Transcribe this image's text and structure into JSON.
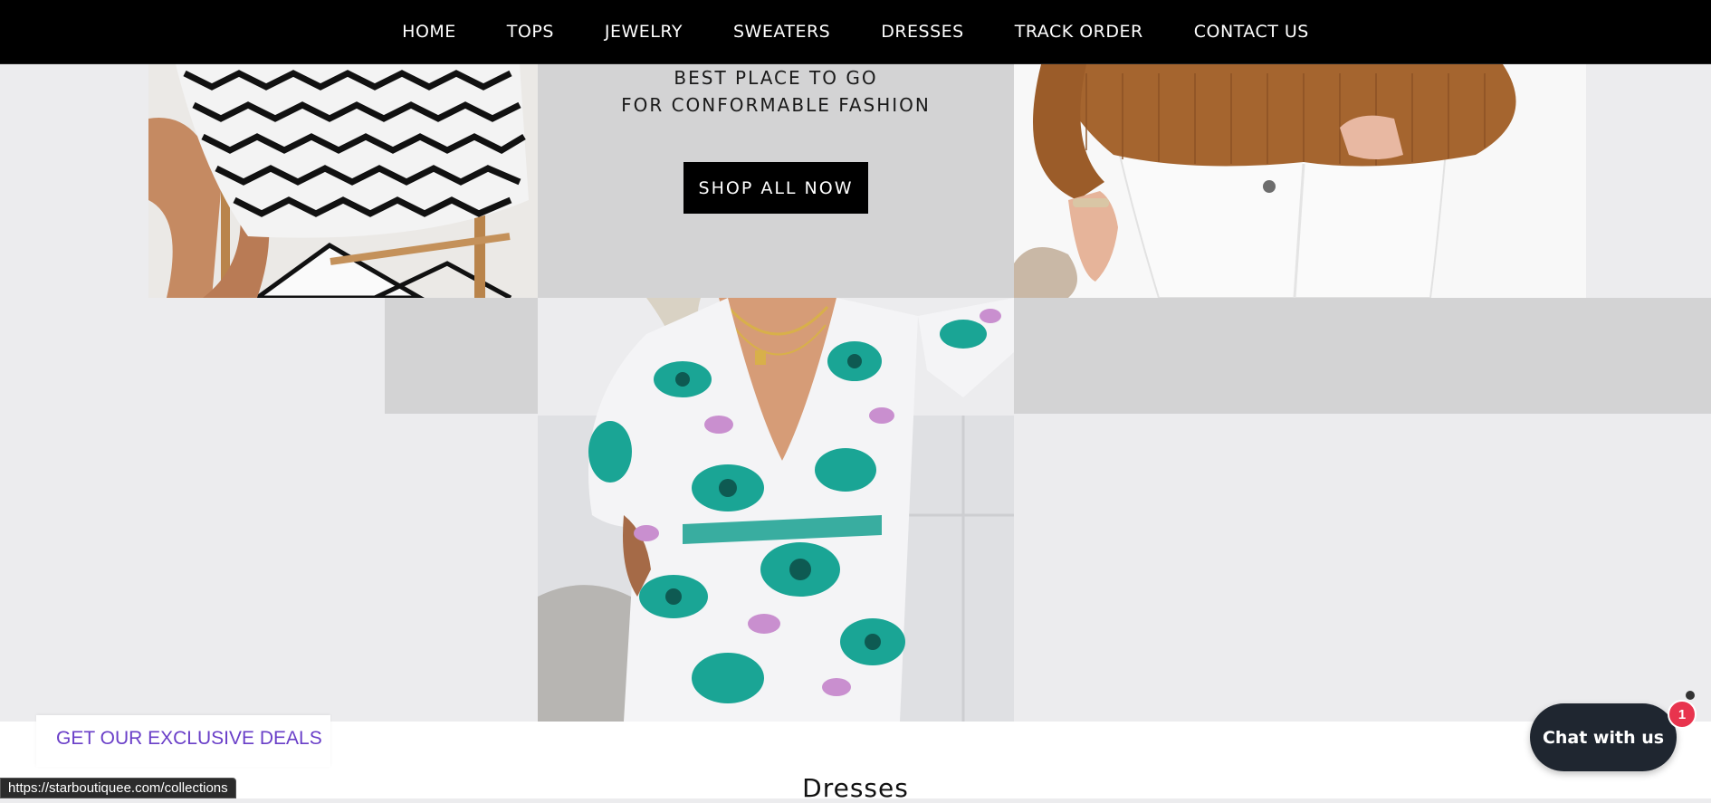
{
  "nav": {
    "items": [
      {
        "label": "HOME"
      },
      {
        "label": "TOPS"
      },
      {
        "label": "JEWELRY"
      },
      {
        "label": "SWEATERS"
      },
      {
        "label": "DRESSES"
      },
      {
        "label": "TRACK ORDER"
      },
      {
        "label": "CONTACT US"
      }
    ]
  },
  "promo": {
    "line1": "BEST PLACE TO GO",
    "line2": "FOR CONFORMABLE FASHION",
    "button_label": "SHOP ALL NOW"
  },
  "deals": {
    "label": "GET OUR EXCLUSIVE DEALS"
  },
  "section": {
    "title": "Dresses"
  },
  "chat": {
    "label": "Chat with us",
    "badge": "1"
  },
  "status_bar": {
    "url": "https://starboutiquee.com/collections"
  },
  "images": {
    "left": "black-white-pattern-dress-photo",
    "right": "brown-sweater-white-jeans-photo",
    "bottom": "teal-paisley-wrap-dress-photo"
  },
  "colors": {
    "nav_bg": "#000000",
    "page_bg": "#ececee",
    "promo_bg": "#d3d3d4",
    "deals_text": "#6a3fc8",
    "chat_bg": "#1f2630",
    "badge": "#e8344e"
  }
}
